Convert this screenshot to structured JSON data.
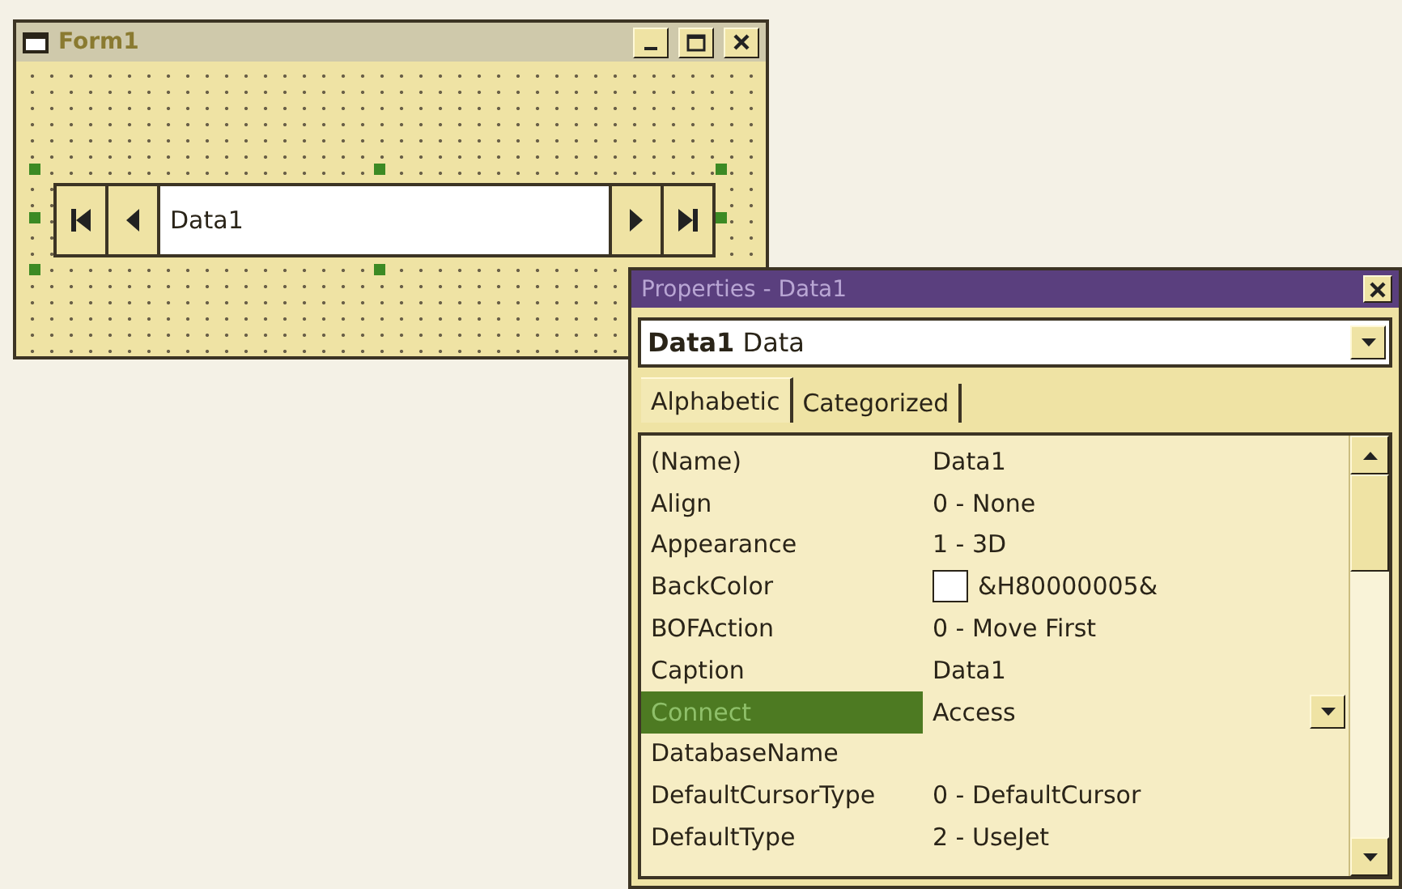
{
  "form_window": {
    "title": "Form1",
    "data_control": {
      "caption": "Data1"
    }
  },
  "properties_window": {
    "title": "Properties - Data1",
    "object_selector": {
      "name": "Data1",
      "type": "Data"
    },
    "tabs": [
      {
        "label": "Alphabetic",
        "selected": true
      },
      {
        "label": "Categorized",
        "selected": false
      }
    ],
    "properties": [
      {
        "name": "(Name)",
        "value": "Data1",
        "kind": "text",
        "selected": false
      },
      {
        "name": "Align",
        "value": "0 - None",
        "kind": "text",
        "selected": false
      },
      {
        "name": "Appearance",
        "value": "1 - 3D",
        "kind": "text",
        "selected": false
      },
      {
        "name": "BackColor",
        "value": "&H80000005&",
        "kind": "color",
        "selected": false
      },
      {
        "name": "BOFAction",
        "value": "0 - Move First",
        "kind": "text",
        "selected": false
      },
      {
        "name": "Caption",
        "value": "Data1",
        "kind": "text",
        "selected": false
      },
      {
        "name": "Connect",
        "value": "Access",
        "kind": "text",
        "selected": true
      },
      {
        "name": "DatabaseName",
        "kind": "text",
        "selected": false
      },
      {
        "name": "DefaultCursorType",
        "value": "0 - DefaultCursor",
        "kind": "text",
        "selected": false
      },
      {
        "name": "DefaultType",
        "value": "2 - UseJet",
        "kind": "text",
        "selected": false
      }
    ]
  }
}
